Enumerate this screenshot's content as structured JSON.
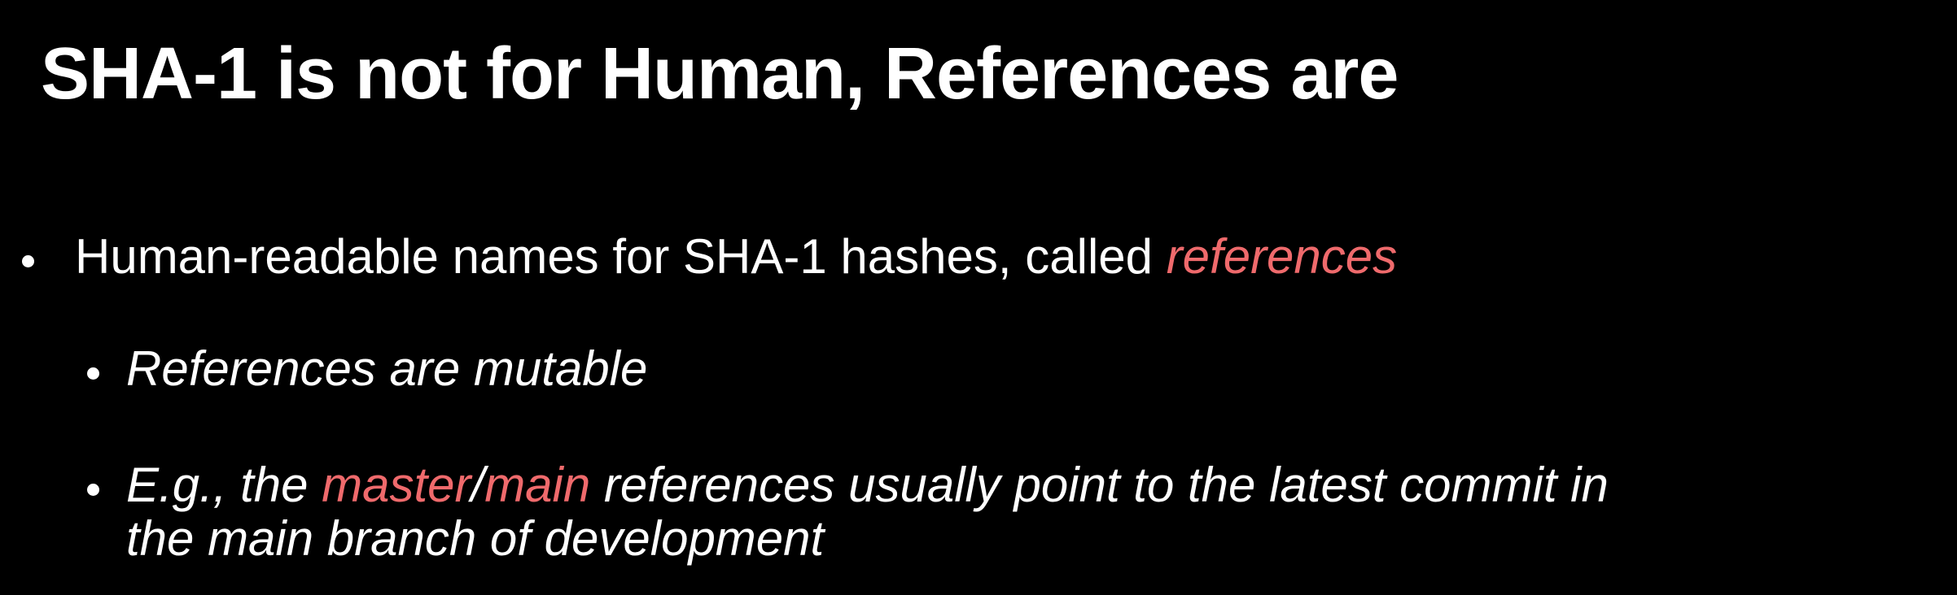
{
  "slide": {
    "title": "SHA-1 is not for Human, References are",
    "accent_color": "#ef6a6c",
    "bullets": [
      {
        "text_before": "Human-readable names for SHA-1 hashes, called ",
        "highlight": "references"
      },
      {
        "text": "References are mutable"
      },
      {
        "prefix": "E.g., the ",
        "highlight1": "master",
        "separator": "/",
        "highlight2": "main",
        "line1_rest": " references usually point to the latest commit in",
        "line2": "the main branch of development"
      }
    ]
  }
}
